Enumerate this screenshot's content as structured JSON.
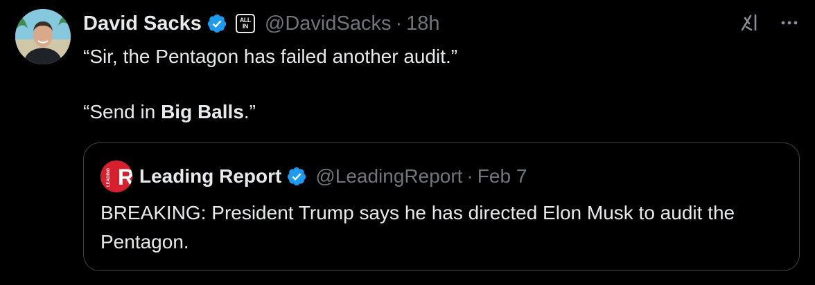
{
  "tweet": {
    "author": {
      "name": "David Sacks",
      "handle": "@DavidSacks",
      "time": "18h",
      "affiliate_badge": [
        "ALL",
        "IN"
      ]
    },
    "separator": "·",
    "text_line1": "“Sir, the Pentagon has failed another audit.”",
    "text_line2_prefix": "“Send in ",
    "text_line2_bold": "Big Balls",
    "text_line2_suffix": ".”",
    "quote": {
      "name": "Leading Report",
      "handle": "@LeadingReport",
      "time": "Feb 7",
      "logo_letter": "R",
      "logo_side_text": "LEADING",
      "text": "BREAKING: President Trump says he has directed Elon Musk to audit the Pentagon."
    }
  },
  "icons": {
    "verified": "verified-badge-icon",
    "grok": "grok-icon",
    "more": "more-options-icon"
  },
  "colors": {
    "background": "#000000",
    "text_primary": "#e7e9ea",
    "text_secondary": "#71767b",
    "verified_blue": "#1d9bf0",
    "border": "#3e4144",
    "brand_red": "#d6202e"
  }
}
